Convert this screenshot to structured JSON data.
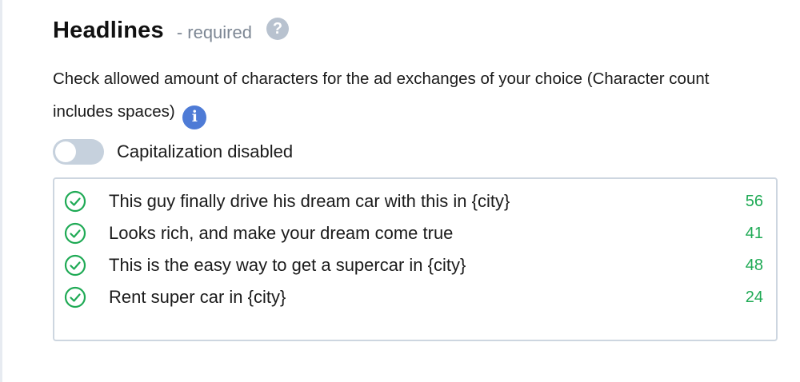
{
  "section": {
    "title": "Headlines",
    "required_label": "- required",
    "help_glyph": "?",
    "description": "Check allowed amount of characters for the ad exchanges of your choice (Character count includes spaces)",
    "info_glyph": "i"
  },
  "capitalization": {
    "label": "Capitalization disabled",
    "enabled": false
  },
  "headlines": [
    {
      "text": "This guy finally drive his dream car with this in {city}",
      "count": "56"
    },
    {
      "text": "Looks rich, and make your dream come true",
      "count": "41"
    },
    {
      "text": "This is the easy way to get a supercar in {city}",
      "count": "48"
    },
    {
      "text": "Rent super car in {city}",
      "count": "24"
    }
  ],
  "colors": {
    "accent_green": "#1faa55",
    "info_blue": "#4e7bd6",
    "help_gray": "#b8c2cf",
    "toggle_off": "#c6d1dd"
  },
  "icons": {
    "help": "question-circle-icon",
    "info": "info-circle-icon",
    "valid": "check-circle-icon"
  }
}
